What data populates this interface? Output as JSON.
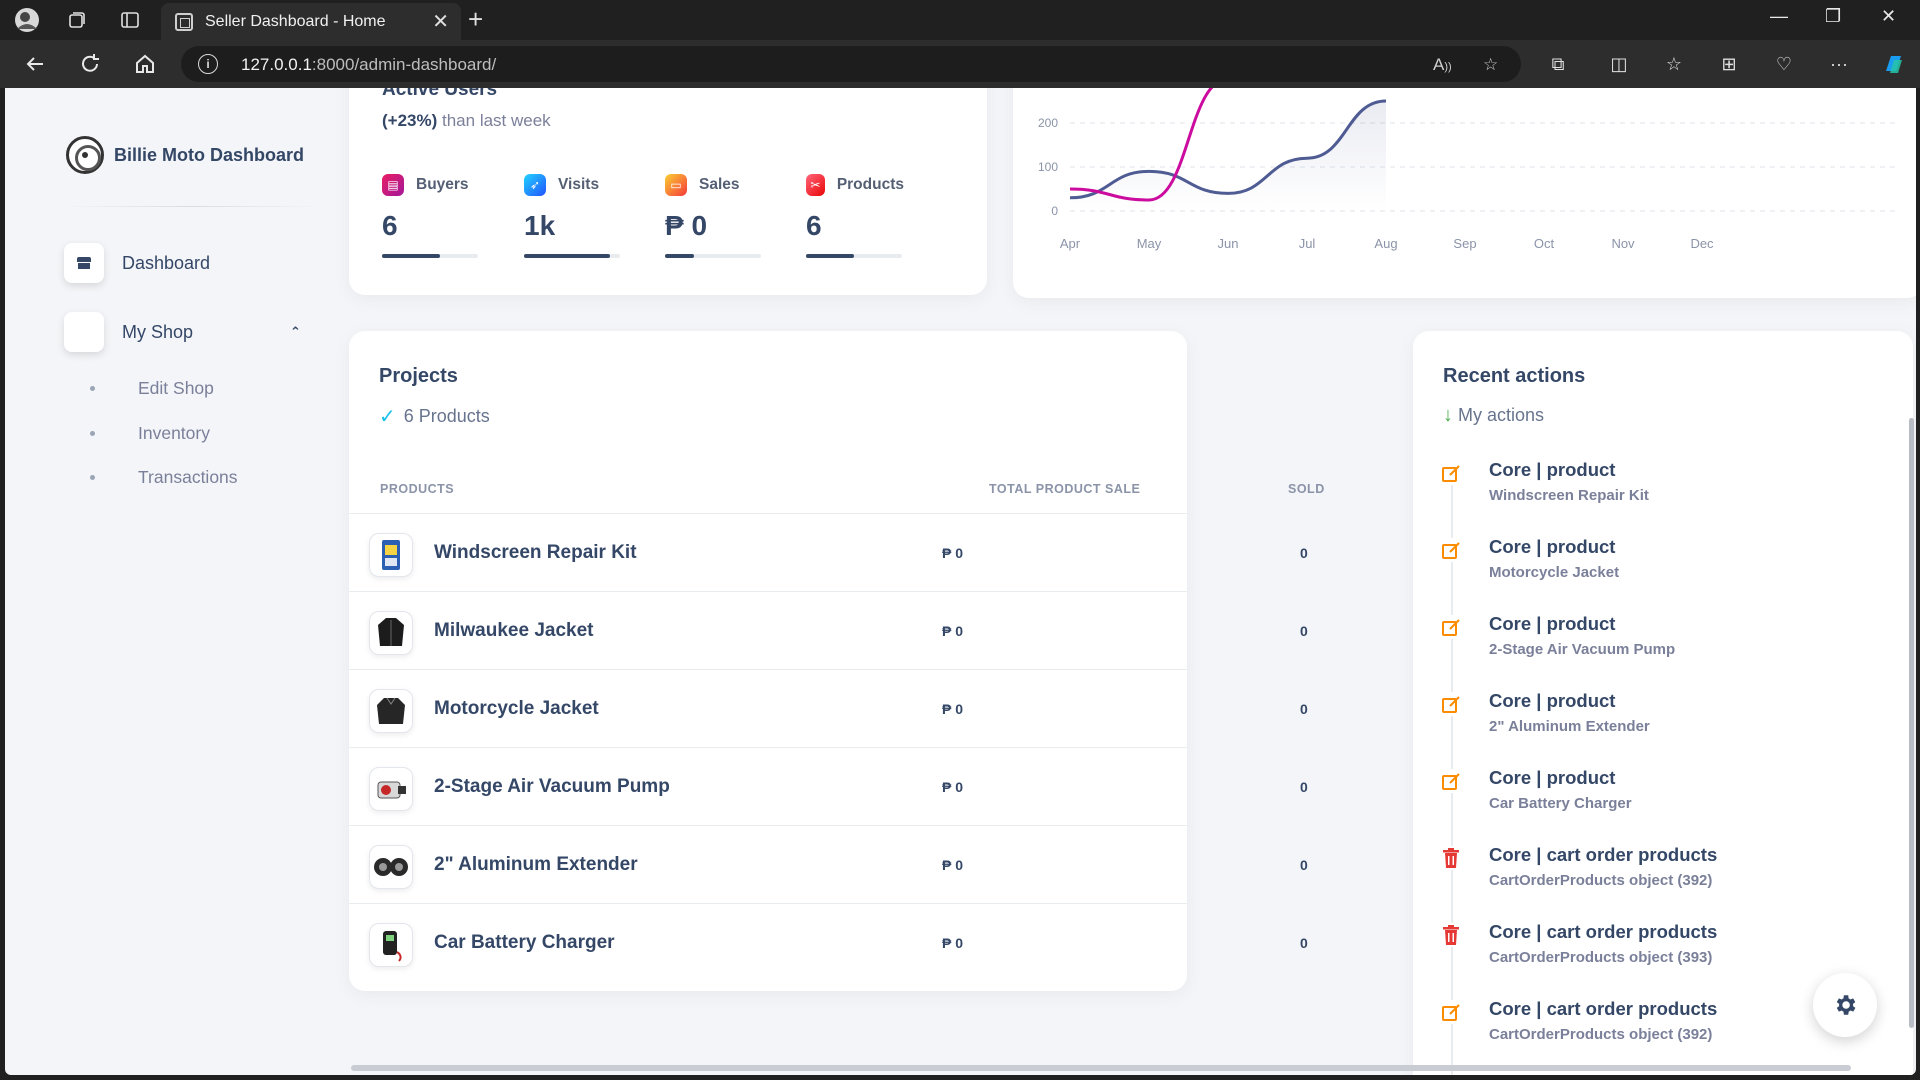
{
  "browser": {
    "tab_title": "Seller Dashboard - Home",
    "url_host": "127.0.0.1",
    "url_rest": ":8000/admin-dashboard/"
  },
  "sidebar": {
    "brand": "Billie Moto Dashboard",
    "items": [
      {
        "label": "Dashboard",
        "icon": "shop-icon"
      },
      {
        "label": "My Shop",
        "icon": "blank-icon",
        "expanded": true
      }
    ],
    "sub_items": [
      {
        "label": "Edit Shop"
      },
      {
        "label": "Inventory"
      },
      {
        "label": "Transactions"
      }
    ]
  },
  "active_users": {
    "title": "Active Users",
    "change": "(+23%)",
    "change_suffix": " than last week",
    "stats": [
      {
        "name": "Buyers",
        "value": "6",
        "progress": 0.6,
        "color": "#c219a5",
        "icon": "credit-card-icon"
      },
      {
        "name": "Visits",
        "value": "1k",
        "progress": 0.9,
        "color": "#1a73e8",
        "icon": "rocket-icon"
      },
      {
        "name": "Sales",
        "value": "₱ 0",
        "progress": 0.3,
        "color": "#fb8c00",
        "icon": "cart-icon"
      },
      {
        "name": "Products",
        "value": "6",
        "progress": 0.5,
        "color": "#e53935",
        "icon": "tools-icon"
      }
    ]
  },
  "chart_data": {
    "type": "line",
    "categories": [
      "Apr",
      "May",
      "Jun",
      "Jul",
      "Aug",
      "Sep",
      "Oct",
      "Nov",
      "Dec"
    ],
    "y_ticks": [
      "200",
      "100",
      "0"
    ],
    "series": [
      {
        "values": [
          30,
          90,
          40,
          120,
          250,
          null,
          null,
          null,
          null
        ],
        "color": "#4f5b93"
      },
      {
        "values": [
          50,
          25,
          300,
          null,
          null,
          null,
          null,
          null,
          null
        ],
        "color": "#cb0c9f"
      }
    ],
    "ylim": [
      0,
      200
    ],
    "grid": true
  },
  "projects": {
    "title": "Projects",
    "subtitle": "6 Products",
    "headers": {
      "product": "PRODUCTS",
      "sale": "TOTAL PRODUCT SALE",
      "sold": "SOLD"
    },
    "rows": [
      {
        "name": "Windscreen Repair Kit",
        "sale": "₱ 0",
        "sold": "0",
        "icon": "repair-kit-thumb"
      },
      {
        "name": "Milwaukee Jacket",
        "sale": "₱ 0",
        "sold": "0",
        "icon": "jacket-thumb"
      },
      {
        "name": "Motorcycle Jacket",
        "sale": "₱ 0",
        "sold": "0",
        "icon": "jacket-thumb"
      },
      {
        "name": "2-Stage Air Vacuum Pump",
        "sale": "₱ 0",
        "sold": "0",
        "icon": "pump-thumb"
      },
      {
        "name": "2\" Aluminum Extender",
        "sale": "₱ 0",
        "sold": "0",
        "icon": "extender-thumb"
      },
      {
        "name": "Car Battery Charger",
        "sale": "₱ 0",
        "sold": "0",
        "icon": "charger-thumb"
      }
    ]
  },
  "recent": {
    "title": "Recent actions",
    "subtitle": "My actions",
    "actions": [
      {
        "title": "Core | product",
        "desc": "Windscreen Repair Kit",
        "type": "edit"
      },
      {
        "title": "Core | product",
        "desc": "Motorcycle Jacket",
        "type": "edit"
      },
      {
        "title": "Core | product",
        "desc": "2-Stage Air Vacuum Pump",
        "type": "edit"
      },
      {
        "title": "Core | product",
        "desc": "2\" Aluminum Extender",
        "type": "edit"
      },
      {
        "title": "Core | product",
        "desc": "Car Battery Charger",
        "type": "edit"
      },
      {
        "title": "Core | cart order products",
        "desc": "CartOrderProducts object (392)",
        "type": "delete"
      },
      {
        "title": "Core | cart order products",
        "desc": "CartOrderProducts object (393)",
        "type": "delete"
      },
      {
        "title": "Core | cart order products",
        "desc": "CartOrderProducts object (392)",
        "type": "edit"
      }
    ]
  }
}
